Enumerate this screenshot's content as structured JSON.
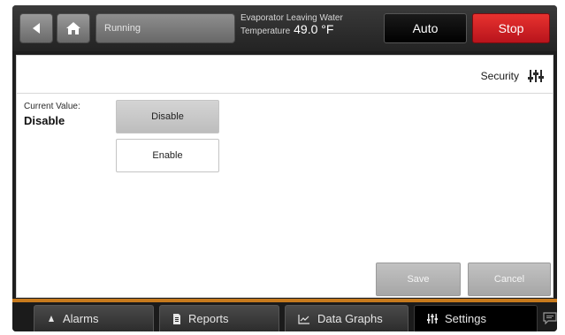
{
  "header": {
    "back_icon": "back-arrow-icon",
    "home_icon": "home-icon",
    "status": "Running",
    "temp_label_line1": "Evaporator Leaving Water",
    "temp_label_line2": "Temperature",
    "temp_value": "49.0 °F",
    "auto_label": "Auto",
    "stop_label": "Stop",
    "stop_color": "#d0202a"
  },
  "content": {
    "title": "Security",
    "title_icon": "settings-sliders-icon",
    "current_label": "Current Value:",
    "current_value": "Disable",
    "options": [
      {
        "label": "Disable",
        "selected": true
      },
      {
        "label": "Enable",
        "selected": false
      }
    ],
    "save_label": "Save",
    "cancel_label": "Cancel"
  },
  "tabs": [
    {
      "label": "Alarms",
      "icon": "bell-icon",
      "active": false
    },
    {
      "label": "Reports",
      "icon": "document-icon",
      "active": false
    },
    {
      "label": "Data Graphs",
      "icon": "line-chart-icon",
      "active": false
    },
    {
      "label": "Settings",
      "icon": "settings-sliders-icon",
      "active": true
    }
  ],
  "chat_icon": "chat-bubble-icon",
  "accent_color": "#c77a1d"
}
